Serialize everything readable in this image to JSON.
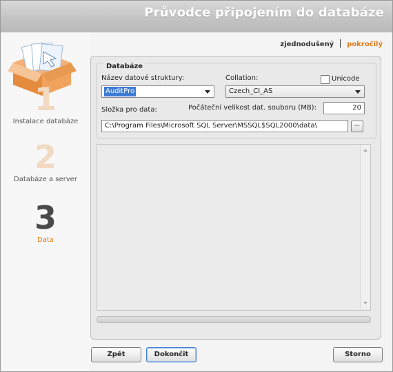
{
  "header": {
    "title": "Průvodce připojením do databáze"
  },
  "steps": [
    {
      "number": "1",
      "label": "Instalace databáze"
    },
    {
      "number": "2",
      "label": "Databáze a server"
    },
    {
      "number": "3",
      "label": "Data"
    }
  ],
  "mode": {
    "simple": "zjednodušený",
    "advanced": "pokročilý"
  },
  "database": {
    "legend": "Databáze",
    "structure_label": "Název datové struktury:",
    "structure_value": "AuditPro",
    "collation_label": "Collation:",
    "collation_value": "Czech_CI_AS",
    "unicode_label": "Unicode",
    "data_folder_label": "Složka pro data:",
    "initial_size_label": "Počáteční velikost dat. souboru (MB):",
    "initial_size_value": "20",
    "path_value": "C:\\Program Files\\Microsoft SQL Server\\MSSQL$SQL2000\\data\\",
    "browse_label": "..."
  },
  "buttons": {
    "back": "Zpět",
    "finish": "Dokončit",
    "cancel": "Storno"
  },
  "colors": {
    "accent": "#e07a19",
    "step_inactive": "#f2d9c2",
    "step_active": "#4a4a4a",
    "selection": "#3d7bd4"
  }
}
